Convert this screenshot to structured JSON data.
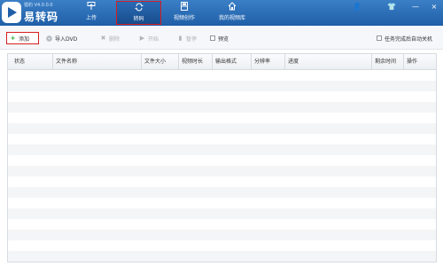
{
  "app": {
    "version": "V4.0.0.0",
    "brand_tag": "猎豹",
    "name": "易转码"
  },
  "nav": {
    "tabs": [
      {
        "label": "上传",
        "icon": "upload-icon"
      },
      {
        "label": "转码",
        "icon": "transcode-icon",
        "active": true
      },
      {
        "label": "视频创作",
        "icon": "film-icon"
      },
      {
        "label": "我的视频库",
        "icon": "home-icon"
      }
    ]
  },
  "window_controls": {
    "user": "👤",
    "skin": "👕",
    "minimize": "—",
    "close": "×"
  },
  "toolbar": {
    "add": "添加",
    "import_dvd": "导入DVD",
    "delete": "删除",
    "start": "开始",
    "pause": "暂停",
    "preview": "预览",
    "shutdown": "任务完成后自动关机"
  },
  "table": {
    "columns": [
      "状态",
      "文件名称",
      "文件大小",
      "视频时长",
      "输出格式",
      "分辨率",
      "进度",
      "剩余时间",
      "操作"
    ],
    "rows": []
  },
  "colors": {
    "titlebar": "#1f5fa8",
    "highlight_border": "#d62020",
    "add_icon": "#2aa83a"
  }
}
